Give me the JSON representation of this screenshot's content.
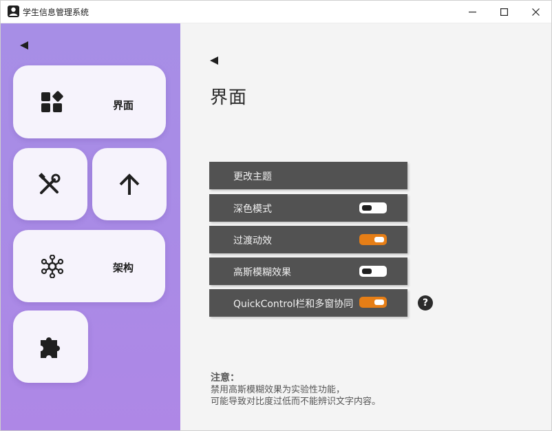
{
  "window": {
    "title": "学生信息管理系统"
  },
  "sidebar": {
    "tiles": [
      {
        "label": "界面",
        "icon": "widgets-icon"
      },
      {
        "label": "",
        "icon": "tools-icon"
      },
      {
        "label": "",
        "icon": "arrow-up-icon"
      },
      {
        "label": "架构",
        "icon": "hub-icon"
      },
      {
        "label": "",
        "icon": "puzzle-icon"
      }
    ]
  },
  "main": {
    "title": "界面",
    "settings": [
      {
        "label": "更改主题",
        "toggle": null
      },
      {
        "label": "深色模式",
        "toggle": "off"
      },
      {
        "label": "过渡动效",
        "toggle": "on"
      },
      {
        "label": "高斯模糊效果",
        "toggle": "off"
      },
      {
        "label": "QuickControl栏和多窗协同",
        "toggle": "on"
      }
    ],
    "help_icon": "?",
    "note": {
      "title": "注意：",
      "lines": [
        "禁用高斯模糊效果为实验性功能，",
        "可能导致对比度过低而不能辨识文字内容。"
      ]
    }
  },
  "colors": {
    "sidebar_bg": "#a98be6",
    "tile_bg": "#f6f3fc",
    "row_bg": "#525252",
    "toggle_on": "#e67e16"
  }
}
